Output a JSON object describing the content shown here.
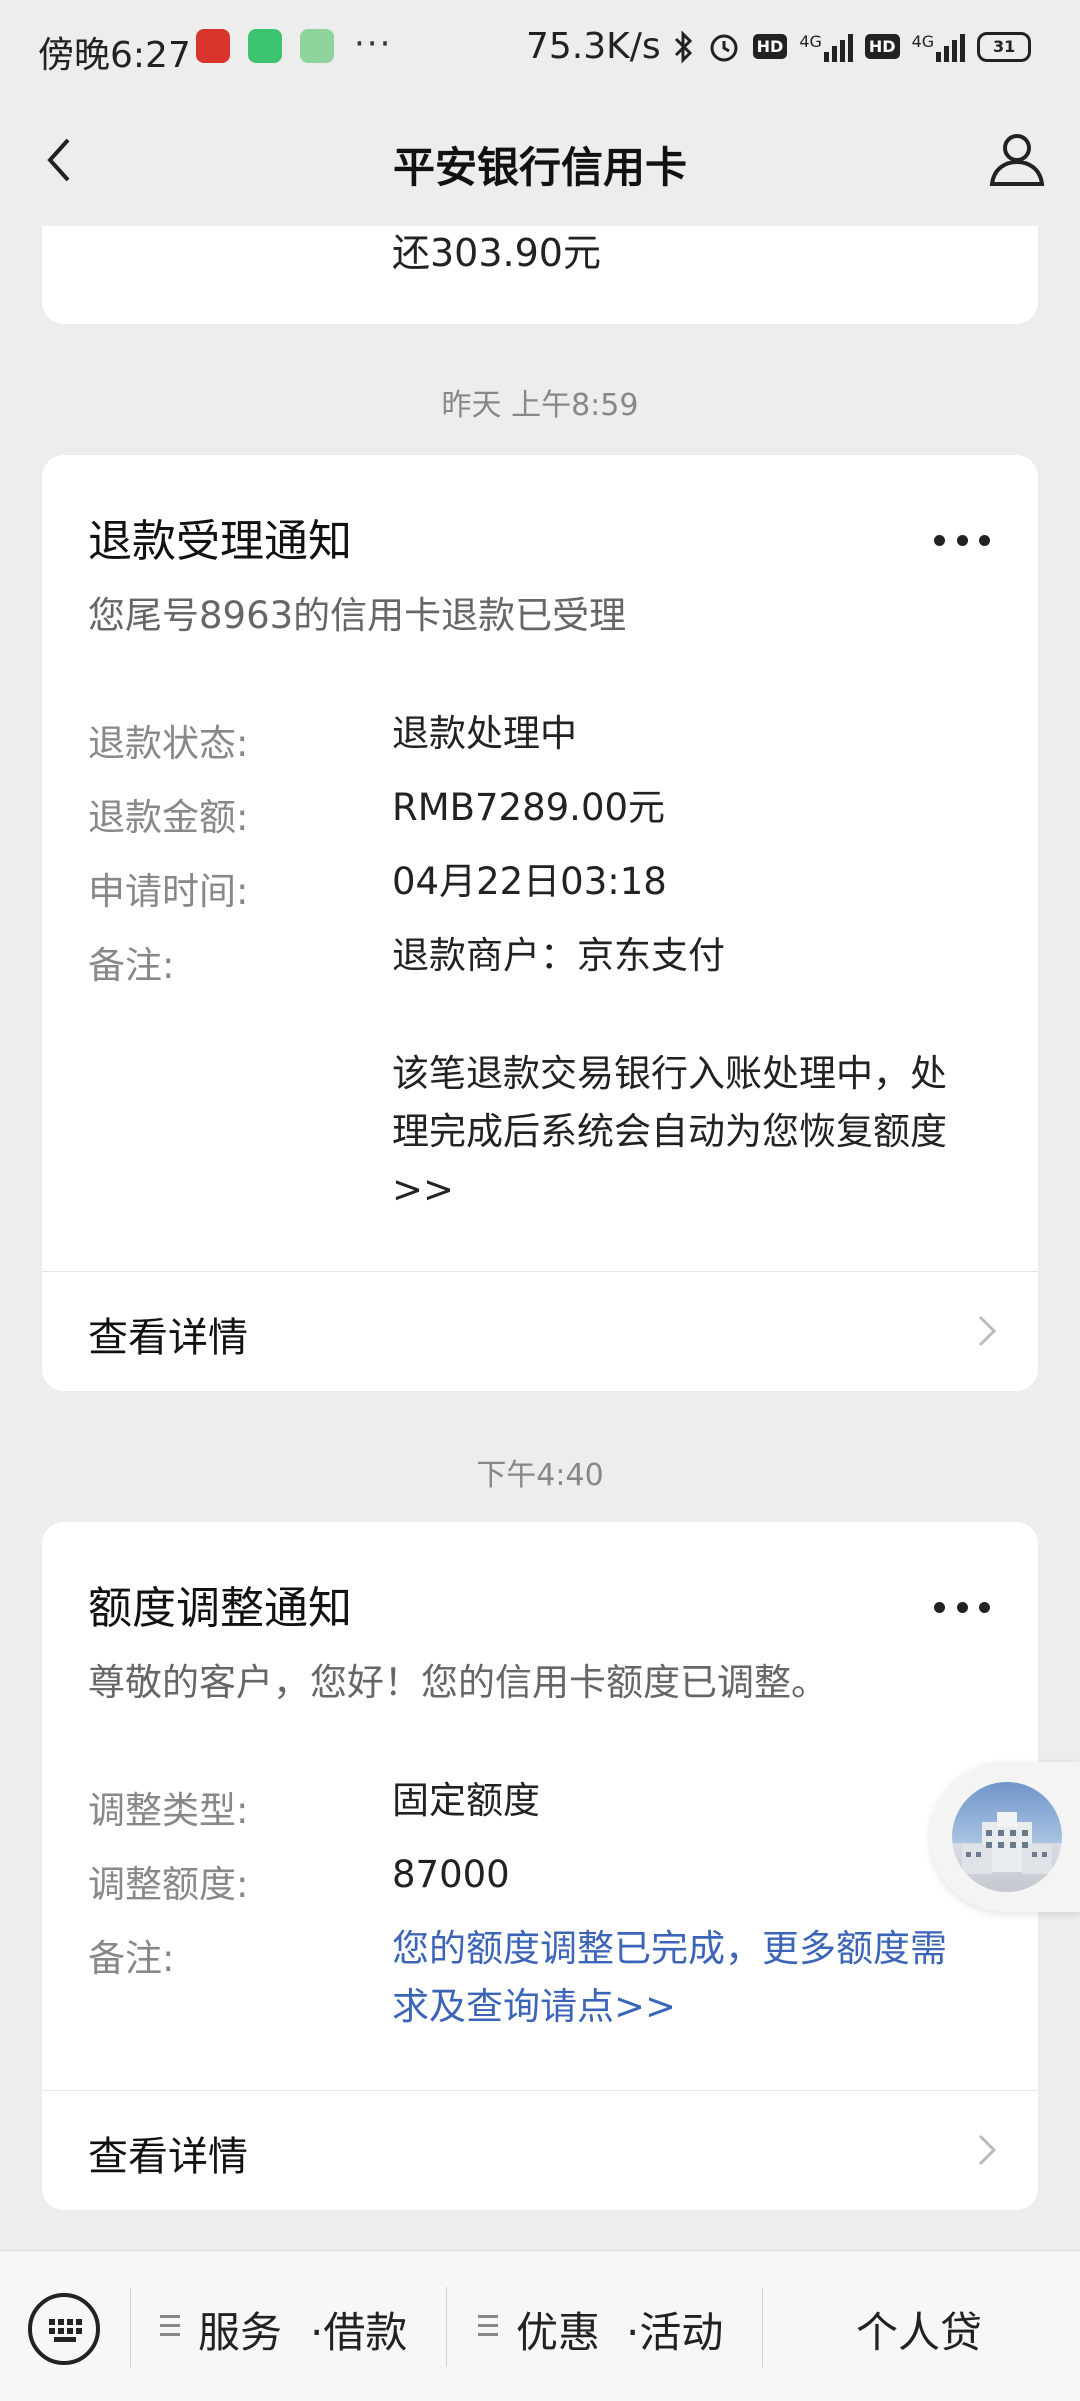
{
  "status_bar": {
    "time": "傍晚6:27",
    "more": "···",
    "net_speed": "75.3K/s",
    "net1": "4G",
    "net2": "4G",
    "hd": "HD",
    "battery": "31"
  },
  "nav": {
    "title": "平安银行信用卡"
  },
  "previous_message": {
    "partial_text": "还303.90元"
  },
  "messages": [
    {
      "timestamp": "昨天 上午8:59",
      "title": "退款受理通知",
      "subtitle": "您尾号8963的信用卡退款已受理",
      "fields": [
        {
          "label": "退款状态:",
          "value": "退款处理中"
        },
        {
          "label": "退款金额:",
          "value": "RMB7289.00元"
        },
        {
          "label": "申请时间:",
          "value": "04月22日03:18"
        },
        {
          "label": "备注:",
          "value": "退款商户：京东支付"
        }
      ],
      "note": "该笔退款交易银行入账处理中，处理完成后系统会自动为您恢复额度>>",
      "detail_label": "查看详情"
    },
    {
      "timestamp": "下午4:40",
      "title": "额度调整通知",
      "subtitle": "尊敬的客户，您好！您的信用卡额度已调整。",
      "fields": [
        {
          "label": "调整类型:",
          "value": "固定额度"
        },
        {
          "label": "调整额度:",
          "value": "87000"
        },
        {
          "label": "备注:",
          "value": "您的额度调整已完成，更多额度需求及查询请点>>"
        }
      ],
      "detail_label": "查看详情"
    }
  ],
  "bottom_menu": {
    "items": [
      {
        "label": "服务"
      },
      {
        "label": "·借款"
      },
      {
        "label": "优惠"
      },
      {
        "label": "·活动"
      },
      {
        "label": "个人贷"
      }
    ]
  },
  "colors": {
    "link": "#3c65b8",
    "background": "#ededed"
  },
  "icons": {
    "back": "chevron-left-icon",
    "profile": "person-icon",
    "more": "more-dots-icon",
    "chevron": "chevron-right-icon",
    "keyboard": "keyboard-icon"
  }
}
